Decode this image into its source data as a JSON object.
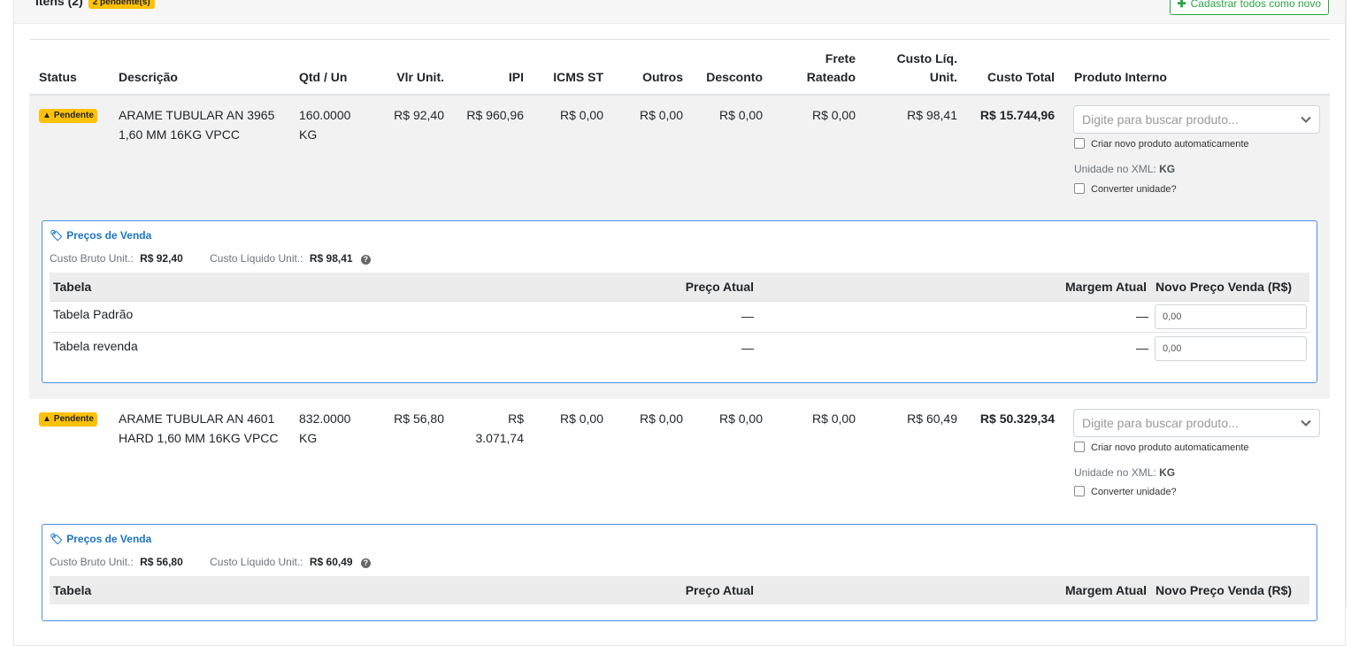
{
  "header": {
    "title": "Itens (2)",
    "pending_badge": "2 pendente(s)",
    "register_all_button": "Cadastrar todos como novo"
  },
  "table": {
    "columns": {
      "status": "Status",
      "descricao": "Descrição",
      "qtd": "Qtd / Un",
      "vlr_unit": "Vlr Unit.",
      "ipi": "IPI",
      "icms_st": "ICMS ST",
      "outros": "Outros",
      "desconto": "Desconto",
      "frete_l1": "Frete",
      "frete_l2": "Rateado",
      "custo_liq_l1": "Custo Líq.",
      "custo_liq_l2": "Unit.",
      "custo_total": "Custo Total",
      "produto_interno": "Produto Interno"
    },
    "rows": [
      {
        "status": "Pendente",
        "desc_l1": "ARAME TUBULAR AN 3965",
        "desc_l2": "1,60 MM 16KG VPCC",
        "qtd": "160.0000",
        "un": "KG",
        "vlr_unit": "R$ 92,40",
        "ipi_l1": "R$ 960,96",
        "ipi_l2": "",
        "icms_st": "R$ 0,00",
        "outros": "R$ 0,00",
        "desconto": "R$ 0,00",
        "frete": "R$ 0,00",
        "custo_liq": "R$ 98,41",
        "custo_total": "R$ 15.744,96",
        "product_placeholder": "Digite para buscar produto...",
        "create_new_label": "Criar novo produto automaticamente",
        "unit_xml_label": "Unidade no XML:",
        "unit_xml_value": "KG",
        "convert_label": "Converter unidade?",
        "prices": {
          "title": "Preços de Venda",
          "custo_bruto_label": "Custo Bruto Unit.:",
          "custo_bruto_value": "R$ 92,40",
          "custo_liq_label": "Custo Líquido Unit.:",
          "custo_liq_value": "R$ 98,41",
          "col_tabela": "Tabela",
          "col_preco_atual": "Preço Atual",
          "col_margem": "Margem Atual",
          "col_novo": "Novo Preço Venda (R$)",
          "tabelas": [
            {
              "name": "Tabela Padrão",
              "preco_atual": "—",
              "margem": "—",
              "novo": "0,00"
            },
            {
              "name": "Tabela revenda",
              "preco_atual": "—",
              "margem": "—",
              "novo": "0,00"
            }
          ]
        }
      },
      {
        "status": "Pendente",
        "desc_l1": "ARAME TUBULAR AN 4601",
        "desc_l2": "HARD 1,60 MM 16KG VPCC",
        "qtd": "832.0000",
        "un": "KG",
        "vlr_unit": "R$ 56,80",
        "ipi_l1": "R$",
        "ipi_l2": "3.071,74",
        "icms_st": "R$ 0,00",
        "outros": "R$ 0,00",
        "desconto": "R$ 0,00",
        "frete": "R$ 0,00",
        "custo_liq": "R$ 60,49",
        "custo_total": "R$ 50.329,34",
        "product_placeholder": "Digite para buscar produto...",
        "create_new_label": "Criar novo produto automaticamente",
        "unit_xml_label": "Unidade no XML:",
        "unit_xml_value": "KG",
        "convert_label": "Converter unidade?",
        "prices": {
          "title": "Preços de Venda",
          "custo_bruto_label": "Custo Bruto Unit.:",
          "custo_bruto_value": "R$ 56,80",
          "custo_liq_label": "Custo Líquido Unit.:",
          "custo_liq_value": "R$ 60,49",
          "col_tabela": "Tabela",
          "col_preco_atual": "Preço Atual",
          "col_margem": "Margem Atual",
          "col_novo": "Novo Preço Venda (R$)"
        }
      }
    ]
  },
  "icons": {
    "warning": "warning-icon",
    "tag": "tag-icon",
    "question": "question-circle-icon",
    "chevron": "chevron-down-icon",
    "plus": "plus-icon"
  },
  "colors": {
    "pending": "#ffc107",
    "link": "#1a73c9",
    "success": "#28a745",
    "box_border": "#4a90e2"
  }
}
